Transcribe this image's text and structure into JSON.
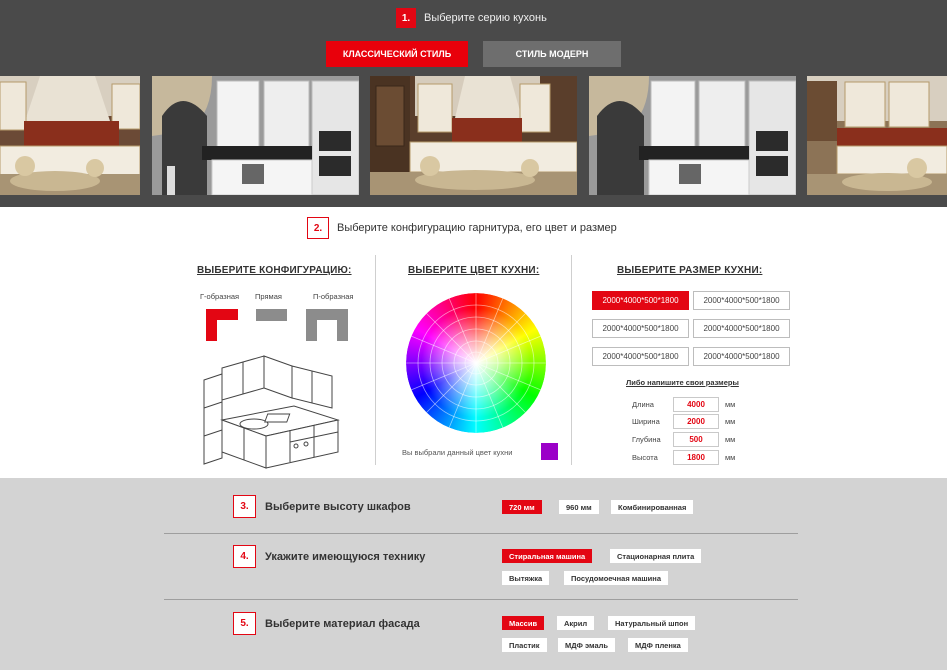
{
  "step1": {
    "number": "1.",
    "label": "Выберите серию кухонь",
    "styles": [
      {
        "label": "КЛАССИЧЕСКИЙ СТИЛЬ",
        "active": true
      },
      {
        "label": "СТИЛЬ МОДЕРН",
        "active": false
      }
    ]
  },
  "step2": {
    "number": "2.",
    "label": "Выберите конфигурацию гарнитура, его цвет и размер",
    "config": {
      "title": "ВЫБЕРИТЕ КОНФИГУРАЦИЮ:",
      "shapes": [
        "Г-образная",
        "Прямая",
        "П-образная"
      ]
    },
    "color": {
      "title": "ВЫБЕРИТЕ ЦВЕТ КУХНИ:",
      "chosen_label": "Вы выбрали данный цвет кухни",
      "chosen_color": "#9b00c8"
    },
    "size": {
      "title": "ВЫБЕРИТЕ РАЗМЕР КУХНИ:",
      "options": [
        "2000*4000*500*1800",
        "2000*4000*500*1800",
        "2000*4000*500*1800",
        "2000*4000*500*1800",
        "2000*4000*500*1800",
        "2000*4000*500*1800"
      ],
      "own_title": "Либо напишите свои размеры",
      "dims": [
        {
          "label": "Длина",
          "value": "4000",
          "unit": "мм"
        },
        {
          "label": "Ширина",
          "value": "2000",
          "unit": "мм"
        },
        {
          "label": "Глубина",
          "value": "500",
          "unit": "мм"
        },
        {
          "label": "Высота",
          "value": "1800",
          "unit": "мм"
        }
      ]
    }
  },
  "step3": {
    "number": "3.",
    "label": "Выберите высоту шкафов",
    "options": [
      "720 мм",
      "960 мм",
      "Комбинированная"
    ]
  },
  "step4": {
    "number": "4.",
    "label": "Укажите имеющуюся технику",
    "options": [
      "Стиральная машина",
      "Стационарная плита",
      "Вытяжка",
      "Посудомоечная машина"
    ]
  },
  "step5": {
    "number": "5.",
    "label": "Выберите материал фасада",
    "options": [
      "Массив",
      "Акрил",
      "Натуральный шпон",
      "Пластик",
      "МДФ эмаль",
      "МДФ пленка"
    ]
  },
  "colors": {
    "accent": "#e30613",
    "dark_bg": "#4a4a4a",
    "grey_bg": "#d3d3d3",
    "inactive_button": "#6e6e6e"
  }
}
